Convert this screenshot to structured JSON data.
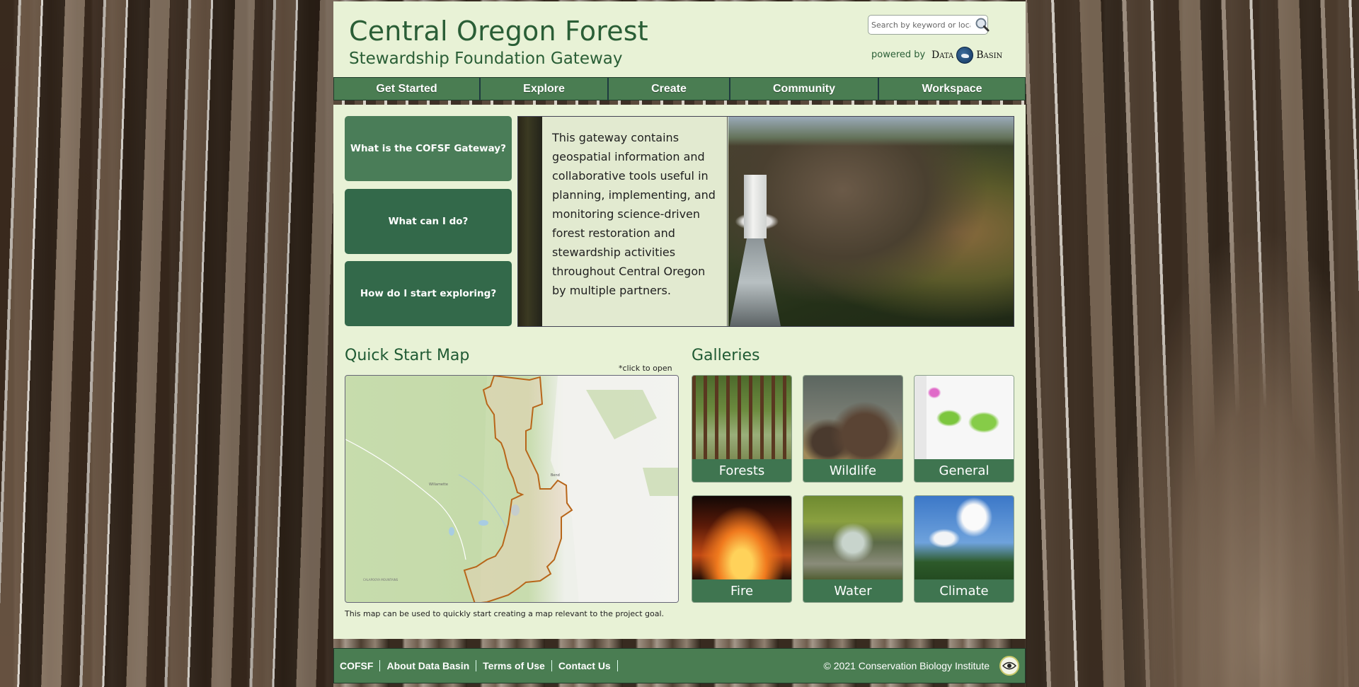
{
  "header": {
    "title": "Central Oregon Forest",
    "subtitle": "Stewardship Foundation Gateway",
    "search_placeholder": "Search by keyword or location",
    "powered_by": "powered by",
    "data_basin_left": "Data",
    "data_basin_right": "Basin"
  },
  "nav": {
    "items": [
      {
        "label": "Get Started"
      },
      {
        "label": "Explore"
      },
      {
        "label": "Create"
      },
      {
        "label": "Community"
      },
      {
        "label": "Workspace"
      }
    ]
  },
  "questions": [
    {
      "label": "What is the COFSF Gateway?"
    },
    {
      "label": "What can I do?"
    },
    {
      "label": "How do I start exploring?"
    }
  ],
  "intro": {
    "text": "This gateway contains geospatial information and collaborative tools useful in planning, implementing, and monitoring science-driven forest restoration and stewardship activities throughout Central Oregon by multiple partners."
  },
  "quick_map": {
    "title": "Quick Start Map",
    "click_note": "*click to open",
    "caption": "This map can be used to quickly start creating a map relevant to the project goal."
  },
  "galleries": {
    "title": "Galleries",
    "items": [
      {
        "label": "Forests"
      },
      {
        "label": "Wildlife"
      },
      {
        "label": "General"
      },
      {
        "label": "Fire"
      },
      {
        "label": "Water"
      },
      {
        "label": "Climate"
      }
    ]
  },
  "footer": {
    "links": [
      {
        "label": "COFSF"
      },
      {
        "label": "About Data Basin"
      },
      {
        "label": "Terms of Use"
      },
      {
        "label": "Contact Us"
      }
    ],
    "copyright": "© 2021 Conservation Biology Institute"
  },
  "colors": {
    "brand_green": "#4a7d52",
    "title_green": "#2a5e36",
    "page_bg": "#e8f2d6",
    "boundary_orange": "#b8661a"
  }
}
